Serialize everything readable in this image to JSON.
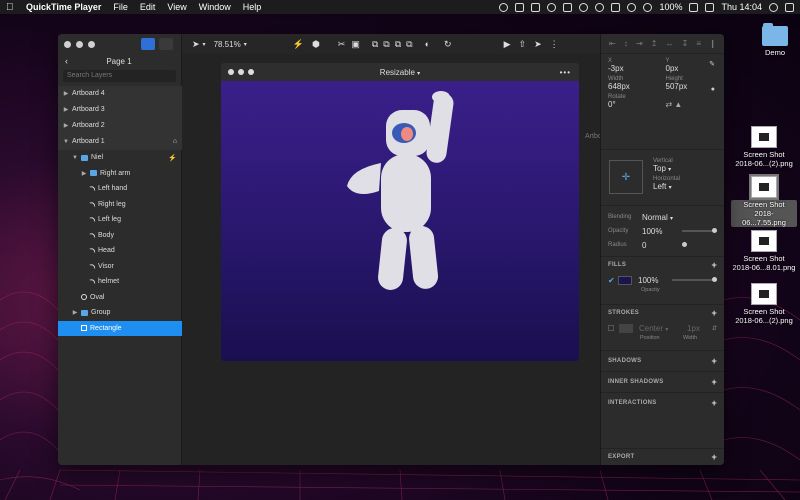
{
  "menubar": {
    "app_name": "QuickTime Player",
    "items": [
      "File",
      "Edit",
      "View",
      "Window",
      "Help"
    ],
    "clock": "Thu 14:04",
    "battery": "100%"
  },
  "left_panel": {
    "page_name": "Page 1",
    "search_placeholder": "Search Layers",
    "layers": [
      {
        "label": "Artboard 4",
        "type": "artboard",
        "caret": "▶",
        "indent": 0
      },
      {
        "label": "Artboard 3",
        "type": "artboard",
        "caret": "▶",
        "indent": 0
      },
      {
        "label": "Artboard 2",
        "type": "artboard",
        "caret": "▶",
        "indent": 0
      },
      {
        "label": "Artboard 1",
        "type": "artboard",
        "caret": "▼",
        "indent": 0
      },
      {
        "label": "Niel",
        "type": "folder",
        "caret": "▼",
        "indent": 1
      },
      {
        "label": "Right arm",
        "type": "folder",
        "caret": "▶",
        "indent": 2
      },
      {
        "label": "Left hand",
        "type": "path",
        "caret": "",
        "indent": 2
      },
      {
        "label": "Right leg",
        "type": "path",
        "caret": "",
        "indent": 2
      },
      {
        "label": "Left leg",
        "type": "path",
        "caret": "",
        "indent": 2
      },
      {
        "label": "Body",
        "type": "path",
        "caret": "",
        "indent": 2
      },
      {
        "label": "Head",
        "type": "path",
        "caret": "",
        "indent": 2
      },
      {
        "label": "Visor",
        "type": "path",
        "caret": "",
        "indent": 2
      },
      {
        "label": "helmet",
        "type": "path",
        "caret": "",
        "indent": 2
      },
      {
        "label": "Oval",
        "type": "oval",
        "caret": "",
        "indent": 1
      },
      {
        "label": "Group",
        "type": "folder",
        "caret": "▶",
        "indent": 1
      },
      {
        "label": "Rectangle",
        "type": "rect",
        "caret": "",
        "indent": 1,
        "selected": true
      }
    ]
  },
  "toolbar": {
    "zoom": "78.51%"
  },
  "canvas": {
    "artboard_title": "Resizable",
    "more": "•••",
    "edge_label": "Artbo"
  },
  "right_panel": {
    "x_label": "X",
    "x_value": "-3px",
    "y_label": "Y",
    "y_value": "0px",
    "width_label": "Width",
    "width_value": "648px",
    "height_label": "Height",
    "height_value": "507px",
    "rotate_label": "Rotate",
    "rotate_value": "0°",
    "vertical_label": "Vertical",
    "vertical_value": "Top",
    "horizontal_label": "Horizontal",
    "horizontal_value": "Left",
    "blending_label": "Blending",
    "blending_value": "Normal",
    "opacity_label": "Opacity",
    "opacity_value": "100%",
    "radius_label": "Radius",
    "radius_value": "0",
    "fills_label": "FILLS",
    "fill_opacity_value": "100%",
    "fill_opacity_label": "Opacity",
    "strokes_label": "STROKES",
    "stroke_position_value": "Center",
    "stroke_position_label": "Position",
    "stroke_width_value": "1px",
    "stroke_width_label": "Width",
    "shadows_label": "SHADOWS",
    "inner_shadows_label": "INNER SHADOWS",
    "interactions_label": "INTERACTIONS",
    "export_label": "EXPORT",
    "fill_color": "#1a1450"
  },
  "desktop": {
    "folder_label": "Demo",
    "files": [
      {
        "line1": "Screen Shot",
        "line2": "2018-06...(2).png",
        "selected": false
      },
      {
        "line1": "Screen Shot",
        "line2": "2018-06...7.55.png",
        "selected": true
      },
      {
        "line1": "Screen Shot",
        "line2": "2018-06...8.01.png",
        "selected": false
      },
      {
        "line1": "Screen Shot",
        "line2": "2018-06...(2).png",
        "selected": false
      }
    ]
  }
}
